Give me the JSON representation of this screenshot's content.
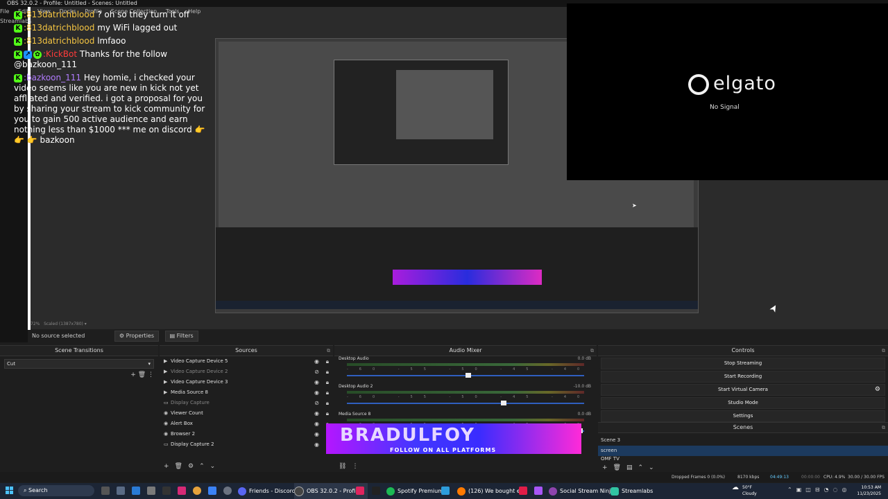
{
  "window": {
    "title": "OBS 32.0.2 - Profile: Untitled - Scenes: Untitled"
  },
  "menu": [
    "File",
    "Edit",
    "View",
    "Docks",
    "Profile",
    "Scene Collection",
    "Tools",
    "Help",
    "Streamlabs"
  ],
  "chat": [
    {
      "user": "",
      "text": "? oh so they turn it off",
      "prefix": ":813datrichblood"
    },
    {
      "user": ":813datrichblood",
      "text": "my WiFi lagged out"
    },
    {
      "user": ":813datrichblood",
      "text": "lmfaoo"
    },
    {
      "user": ":KickBot",
      "text": "Thanks for the follow @bazkoon_111"
    },
    {
      "user": ":bazkoon_111",
      "text": "Hey homie, i checked your video seems like you are new in kick not yet affliated and verified. i got a proposal for you by sharing your stream to kick community for you to gain 500 active audience and earn nothing less than $1000 *** me on discord 👉 👉 👉 bazkoon"
    }
  ],
  "elgato": {
    "logo": "elgato",
    "status": "No Signal"
  },
  "preview_status": {
    "zoom": "72%",
    "scaled": "Scaled (1387x780)"
  },
  "source_bar": {
    "no_source": "No source selected",
    "properties": "Properties",
    "filters": "Filters"
  },
  "scene_transitions": {
    "title": "Scene Transitions",
    "selected": "Cut"
  },
  "sources": {
    "title": "Sources",
    "items": [
      {
        "name": "Video Capture Device 5",
        "dim": false,
        "icon": "▶"
      },
      {
        "name": "Video Capture Device 2",
        "dim": true,
        "icon": "▶"
      },
      {
        "name": "Video Capture Device 3",
        "dim": false,
        "icon": "▶"
      },
      {
        "name": "Media Source 8",
        "dim": false,
        "icon": "▶"
      },
      {
        "name": "Display Capture",
        "dim": true,
        "icon": "▭"
      },
      {
        "name": "Viewer Count",
        "dim": false,
        "icon": "◉"
      },
      {
        "name": "Alert Box",
        "dim": false,
        "icon": "◉"
      },
      {
        "name": "Browser 2",
        "dim": false,
        "icon": "◉"
      },
      {
        "name": "Display Capture 2",
        "dim": false,
        "icon": "▭"
      }
    ]
  },
  "mixer": {
    "title": "Audio Mixer",
    "channels": [
      {
        "name": "Desktop Audio",
        "db": "0.0 dB",
        "level": 0.5
      },
      {
        "name": "Desktop Audio 2",
        "db": "-10.0 dB",
        "level": 0.65
      },
      {
        "name": "Media Source 8",
        "db": "0.0 dB",
        "level": 0.97
      }
    ],
    "banner_big": "BRADULFOY",
    "banner_small": "FOLLOW ON ALL PLATFORMS"
  },
  "controls": {
    "title": "Controls",
    "buttons": [
      "Stop Streaming",
      "Start Recording",
      "Start Virtual Camera",
      "Studio Mode",
      "Settings"
    ]
  },
  "scenes": {
    "title": "Scenes",
    "items": [
      "Scene 3",
      "screen",
      "OMF TV"
    ],
    "selected": 1
  },
  "status": {
    "dropped": "Dropped Frames 0 (0.0%)",
    "kbps": "8170 kbps",
    "live_time": "04:49:13",
    "rec_time": "00:00:00",
    "cpu": "CPU: 4.9%",
    "fps": "30.00 / 30.00 FPS"
  },
  "taskbar": {
    "search": "Search",
    "apps": [
      {
        "label": "Friends - Discord",
        "color": "#5865f2"
      },
      {
        "label": "OBS 32.0.2 - Profile:",
        "color": "#444"
      },
      {
        "label": "Spotify Premium",
        "color": "#1db954"
      },
      {
        "label": "(126) We bought eve",
        "color": "#ff3d00"
      },
      {
        "label": "Social Stream Ninja -",
        "color": "#8e44ad"
      },
      {
        "label": "Streamlabs",
        "color": "#31c3a2"
      }
    ],
    "weather_temp": "50°F",
    "weather_desc": "Cloudy",
    "time": "10:53 AM",
    "date": "11/23/2025"
  }
}
